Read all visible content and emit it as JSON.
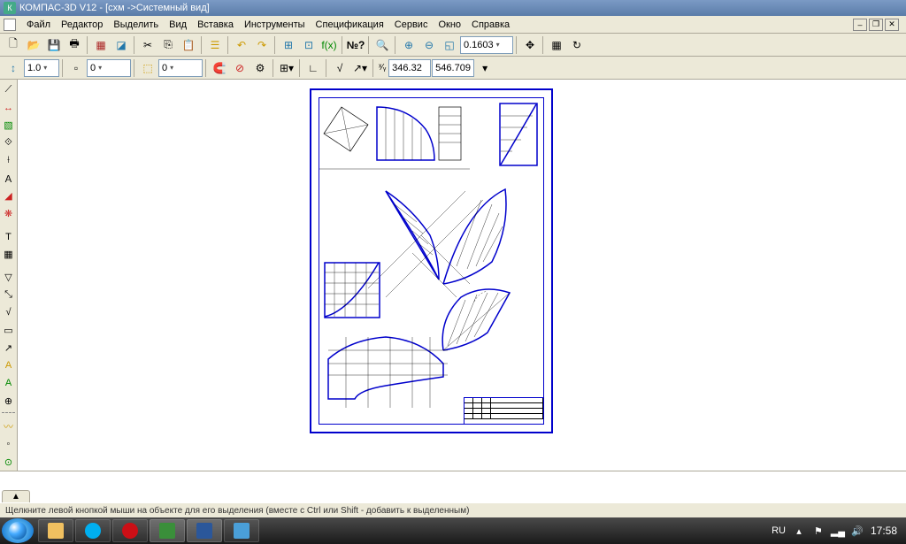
{
  "title": "КОМПАС-3D V12 - [схм ->Системный вид]",
  "menu": {
    "file": "Файл",
    "editor": "Редактор",
    "select": "Выделить",
    "view": "Вид",
    "insert": "Вставка",
    "instruments": "Инструменты",
    "spec": "Спецификация",
    "service": "Сервис",
    "window": "Окно",
    "help": "Справка"
  },
  "toolbar2": {
    "line_width": "1.0",
    "step": "0",
    "layer": "0",
    "coord_x": "346.32",
    "coord_y": "546.709"
  },
  "zoom": "0.1603",
  "status": "Щелкните левой кнопкой мыши на объекте для его выделения (вместе с Ctrl или Shift - добавить к выделенным)",
  "bottom_arrow": "▲",
  "tray": {
    "lang": "RU",
    "clock": "17:58"
  }
}
